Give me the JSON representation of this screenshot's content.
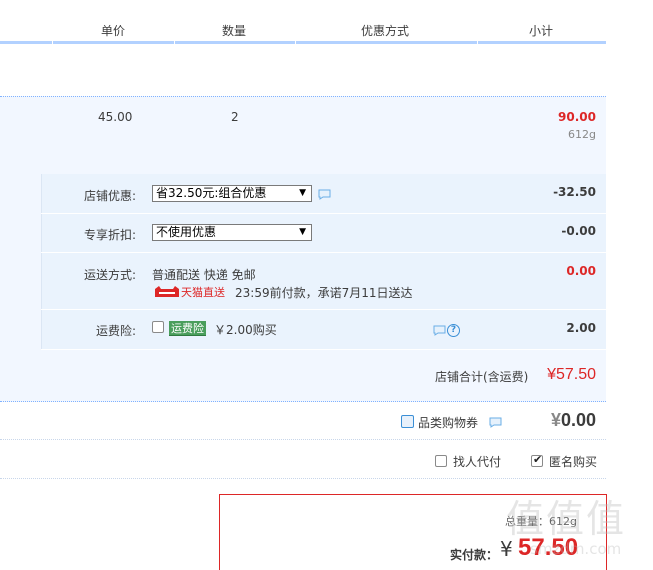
{
  "header": {
    "col_unit_price": "单价",
    "col_quantity": "数量",
    "col_discount": "优惠方式",
    "col_subtotal": "小计"
  },
  "item": {
    "unit_price": "45.00",
    "quantity": "2",
    "subtotal": "90.00",
    "weight": "612g"
  },
  "store_discount": {
    "label": "店铺优惠:",
    "selected": "省32.50元:组合优惠",
    "amount": "-32.50"
  },
  "exclusive_discount": {
    "label": "专享折扣:",
    "selected": "不使用优惠",
    "amount": "-0.00"
  },
  "shipping": {
    "label": "运送方式:",
    "method": "普通配送 快递 免邮",
    "service": "天猫直送",
    "promise": "23:59前付款，承诺7月11日送达",
    "amount": "0.00"
  },
  "shipping_insurance": {
    "label": "运费险:",
    "badge": "运费险",
    "price": "￥2.00购买",
    "amount": "2.00"
  },
  "store_total": {
    "label": "店铺合计(含运费)",
    "value": "¥57.50"
  },
  "coupon": {
    "label": "品类购物券",
    "currency": "¥",
    "value": "0.00"
  },
  "options": {
    "proxy_pay": "找人代付",
    "anonymous": "匿名购买"
  },
  "payment": {
    "weight": "总重量：612g",
    "label": "实付款：",
    "currency": "¥",
    "value": "57.50"
  },
  "watermark": {
    "text": "值值值",
    "site": "smzdm.com"
  },
  "colors": {
    "accent_red": "#dd2727",
    "header_line": "#b2d1ff",
    "panel_bg": "#f2f7ff"
  }
}
